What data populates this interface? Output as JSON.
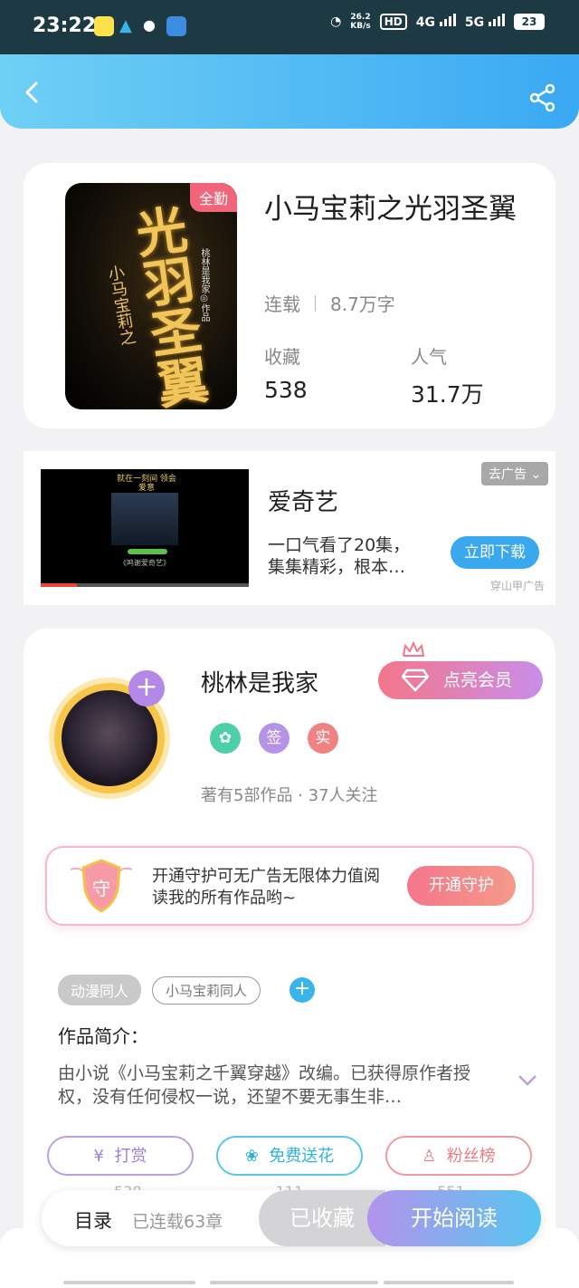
{
  "status_bar": {
    "time": "23:22",
    "speed_value": "26.2",
    "speed_unit": "KB/s",
    "hd": "HD",
    "net1": "4G",
    "net2": "5G",
    "battery": "23"
  },
  "book": {
    "badge": "全勤",
    "cover_title": "光羽圣翼",
    "cover_subtitle": "小马宝莉之",
    "cover_author": "桃林是我家◎作品",
    "title": "小马宝莉之光羽圣翼",
    "status": "连载",
    "word_count": "8.7万字",
    "favorites_label": "收藏",
    "favorites_value": "538",
    "popularity_label": "人气",
    "popularity_value": "31.7万"
  },
  "ad": {
    "video_caption_top": "就在一刻间 领会爱意",
    "video_caption_bottom": "《鸣谢爱奇艺》",
    "app_name": "爱奇艺",
    "description": "一口气看了20集，集集精彩，根本…",
    "download_label": "立即下载",
    "close_label": "去广告",
    "source": "穿山甲广告"
  },
  "author": {
    "name": "桃林是我家",
    "vip_label": "点亮会员",
    "badges": [
      "签",
      "实"
    ],
    "stats": "著有5部作品 · 37人关注"
  },
  "guard": {
    "shield_char": "守",
    "text": "开通守护可无广告无限体力值阅读我的所有作品哟~",
    "button": "开通守护"
  },
  "tags": [
    "动漫同人",
    "小马宝莉同人"
  ],
  "intro": {
    "label": "作品简介：",
    "text": "由小说《小马宝莉之千翼穿越》改编。已获得原作者授权，没有任何侵权一说，还望不要无事生非…"
  },
  "actions": {
    "tip": "打赏",
    "flower": "免费送花",
    "fans": "粉丝榜",
    "nums": [
      "538",
      "111",
      "551"
    ]
  },
  "bottom": {
    "toc": "目录",
    "chapters": "已连载63章",
    "collected": "已收藏",
    "start": "开始阅读"
  },
  "colors": {
    "accent_blue": "#3aa9f3",
    "pink": "#f4768a",
    "purple": "#b488e6"
  }
}
